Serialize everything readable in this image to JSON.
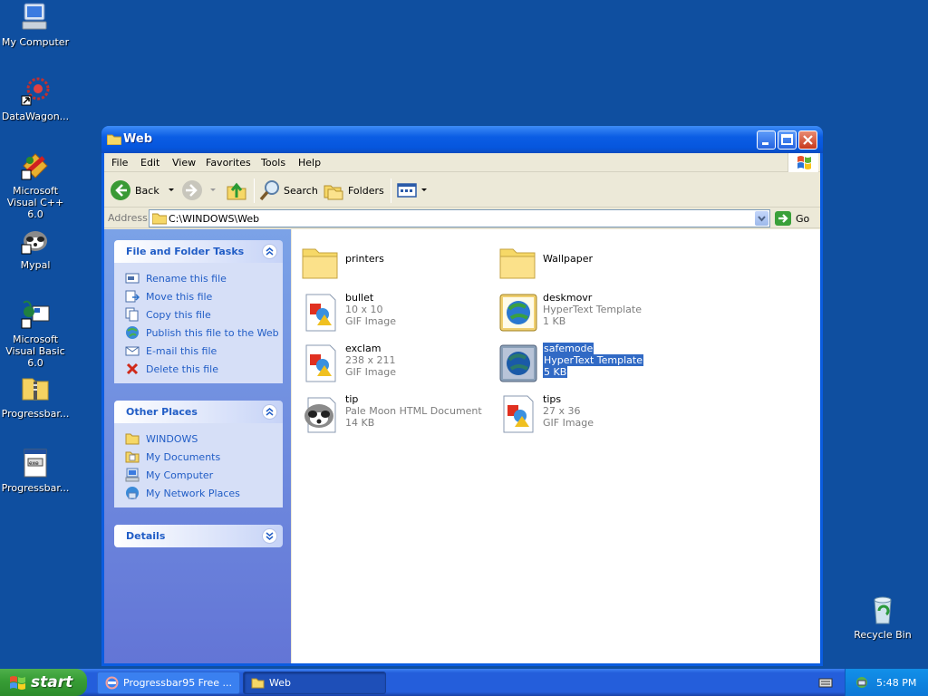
{
  "desktop": {
    "icons": [
      {
        "label": "My Computer",
        "icon": "my-computer-icon"
      },
      {
        "label": "DataWagon...",
        "icon": "datawagon-icon"
      },
      {
        "label": "Microsoft Visual C++ 6.0",
        "icon": "visual-cpp-icon"
      },
      {
        "label": "Mypal",
        "icon": "mypal-icon"
      },
      {
        "label": "Microsoft Visual Basic 6.0",
        "icon": "visual-basic-icon"
      },
      {
        "label": "Progressbar...",
        "icon": "zip-icon"
      },
      {
        "label": "Progressbar...",
        "icon": "exe-icon"
      },
      {
        "label": "Recycle Bin",
        "icon": "recycle-bin-icon"
      }
    ]
  },
  "window": {
    "title": "Web",
    "menu": [
      "File",
      "Edit",
      "View",
      "Favorites",
      "Tools",
      "Help"
    ],
    "toolbar": {
      "back": "Back",
      "search": "Search",
      "folders": "Folders"
    },
    "address": {
      "label": "Address",
      "value": "C:\\WINDOWS\\Web",
      "go": "Go"
    }
  },
  "taskpane": {
    "file_tasks": {
      "title": "File and Folder Tasks",
      "items": [
        {
          "label": "Rename this file",
          "icon": "rename-icon"
        },
        {
          "label": "Move this file",
          "icon": "move-icon"
        },
        {
          "label": "Copy this file",
          "icon": "copy-icon"
        },
        {
          "label": "Publish this file to the Web",
          "icon": "publish-icon"
        },
        {
          "label": "E-mail this file",
          "icon": "email-icon"
        },
        {
          "label": "Delete this file",
          "icon": "delete-icon"
        }
      ]
    },
    "other_places": {
      "title": "Other Places",
      "items": [
        {
          "label": "WINDOWS",
          "icon": "folder-icon"
        },
        {
          "label": "My Documents",
          "icon": "my-documents-icon"
        },
        {
          "label": "My Computer",
          "icon": "my-computer-icon"
        },
        {
          "label": "My Network Places",
          "icon": "network-places-icon"
        }
      ]
    },
    "details": {
      "title": "Details"
    }
  },
  "files": [
    {
      "name": "printers",
      "type": "folder",
      "icon": "folder-icon"
    },
    {
      "name": "Wallpaper",
      "type": "folder",
      "icon": "folder-icon"
    },
    {
      "name": "bullet",
      "line2": "10 x 10",
      "line3": "GIF Image",
      "icon": "gif-image-icon"
    },
    {
      "name": "deskmovr",
      "line2": "HyperText Template",
      "line3": "1 KB",
      "icon": "htt-template-icon"
    },
    {
      "name": "exclam",
      "line2": "238 x 211",
      "line3": "GIF Image",
      "icon": "gif-image-icon"
    },
    {
      "name": "safemode",
      "line2": "HyperText Template",
      "line3": "5 KB",
      "icon": "htt-template-icon",
      "selected": true
    },
    {
      "name": "tip",
      "line2": "Pale Moon HTML Document",
      "line3": "14 KB",
      "icon": "pale-moon-html-icon"
    },
    {
      "name": "tips",
      "line2": "27 x 36",
      "line3": "GIF Image",
      "icon": "gif-image-icon"
    }
  ],
  "taskbar": {
    "start": "start",
    "tasks": [
      {
        "label": "Progressbar95 Free ...",
        "icon": "progressbar-app-icon"
      },
      {
        "label": "Web",
        "icon": "folder-icon"
      }
    ],
    "clock": "5:48 PM"
  },
  "colors": {
    "desktop": "#0f4fa0",
    "titlebar": "#0b5de4",
    "taskpane_link": "#215dc6",
    "selection": "#316ac5",
    "start": "#389e36"
  }
}
